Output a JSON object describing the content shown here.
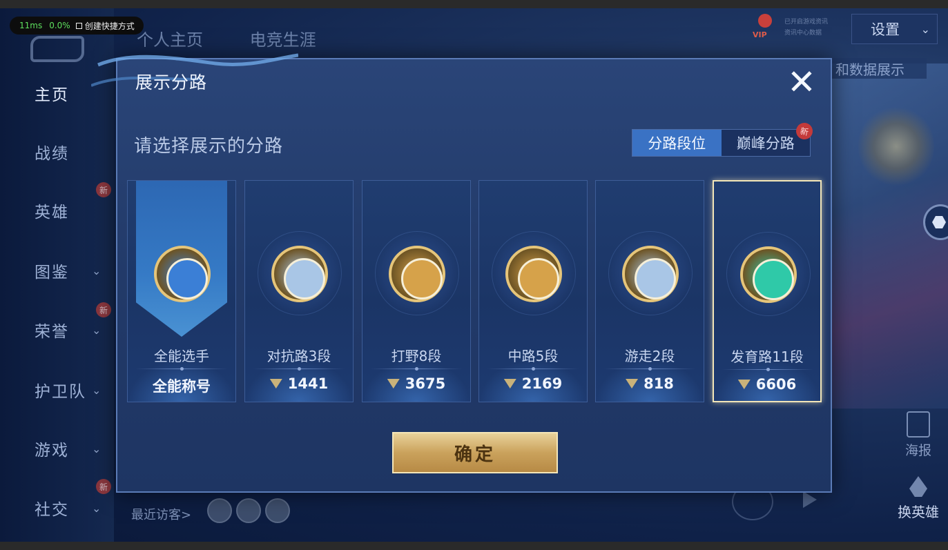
{
  "hud": {
    "latency": "11ms",
    "percent": "0.0%",
    "shortcut": "创建快捷方式"
  },
  "top_tabs": [
    "个人主页",
    "电竞生涯"
  ],
  "settings": "设置",
  "vip_label": "VIP",
  "top_small": [
    "已开启游戏资讯",
    "资讯中心数据"
  ],
  "data_pill": "和数据展示",
  "sidebar": {
    "items": [
      {
        "label": "主页",
        "active": true,
        "chevron": false,
        "new": false
      },
      {
        "label": "战绩",
        "active": false,
        "chevron": false,
        "new": false
      },
      {
        "label": "英雄",
        "active": false,
        "chevron": false,
        "new": true
      },
      {
        "label": "图鉴",
        "active": false,
        "chevron": true,
        "new": false
      },
      {
        "label": "荣誉",
        "active": false,
        "chevron": true,
        "new": true
      },
      {
        "label": "护卫队",
        "active": false,
        "chevron": true,
        "new": false
      },
      {
        "label": "游戏",
        "active": false,
        "chevron": true,
        "new": false
      },
      {
        "label": "社交",
        "active": false,
        "chevron": true,
        "new": true
      }
    ],
    "new_label": "新"
  },
  "recent_visitors": "最近访客>",
  "right_panel": {
    "poster": "海报",
    "swap_hero": "换英雄"
  },
  "modal": {
    "title": "展示分路",
    "subtitle": "请选择展示的分路",
    "tabs": [
      {
        "label": "分路段位",
        "active": true
      },
      {
        "label": "巅峰分路",
        "active": false,
        "new": "新"
      }
    ],
    "cards": [
      {
        "lane": "全能选手",
        "value": "全能称号",
        "emblem": "allround-emblem-icon",
        "color": "#3b7fd6",
        "selected": false
      },
      {
        "lane": "对抗路3段",
        "value": "1441",
        "emblem": "clash-lane-emblem-icon",
        "color": "#a9c6e6",
        "selected": false
      },
      {
        "lane": "打野8段",
        "value": "3675",
        "emblem": "jungle-emblem-icon",
        "color": "#d6a24a",
        "selected": false
      },
      {
        "lane": "中路5段",
        "value": "2169",
        "emblem": "mid-lane-emblem-icon",
        "color": "#d6a24a",
        "selected": false
      },
      {
        "lane": "游走2段",
        "value": "818",
        "emblem": "roam-emblem-icon",
        "color": "#a9c6e6",
        "selected": false
      },
      {
        "lane": "发育路11段",
        "value": "6606",
        "emblem": "farm-lane-emblem-icon",
        "color": "#2fc9a8",
        "selected": true
      }
    ],
    "confirm": "确定",
    "close_icon": "close-icon"
  }
}
